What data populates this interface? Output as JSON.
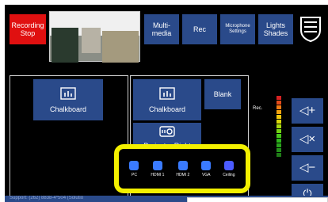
{
  "top_bar": {
    "recording_stop": "Recording\nStop",
    "multimedia": "Multi-\nmedia",
    "rec": "Rec",
    "microphone_settings": "Microphone\nSettings",
    "lights_shades": "Lights\nShades"
  },
  "left_display": {
    "label": "Chalkboard"
  },
  "right_display": {
    "label": "Chalkboard",
    "blank": "Blank",
    "projector_label": "Projector Right"
  },
  "sources": [
    {
      "label": "PC",
      "color": "#3a7bff"
    },
    {
      "label": "HDMI 1",
      "color": "#3a7bff"
    },
    {
      "label": "HDMI 2",
      "color": "#3a7bff"
    },
    {
      "label": "VGA",
      "color": "#3a7bff"
    },
    {
      "label": "Ceiling",
      "color": "#4b5bff"
    }
  ],
  "meter": {
    "label": "Rec."
  },
  "volume": {
    "up": "◁+",
    "mute": "◁×",
    "down": "◁−",
    "power": "⏻"
  },
  "status_bar": {
    "text": "Support: (262) 8838-4*504 (Solutio"
  },
  "colors": {
    "highlight": "#f3f000",
    "button": "#2a4a8a",
    "record": "#e01010"
  }
}
